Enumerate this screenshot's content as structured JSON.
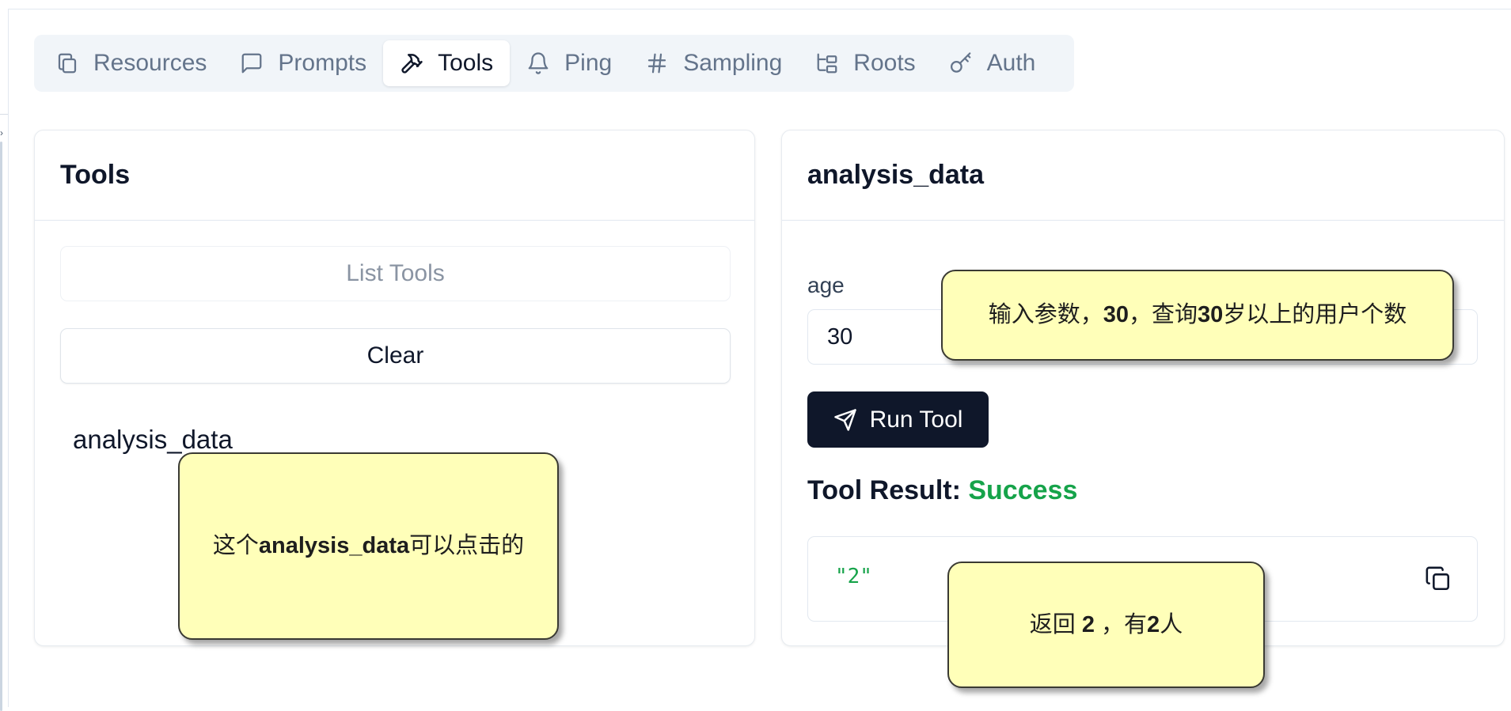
{
  "tabs": [
    {
      "label": "Resources",
      "icon": "copy-icon",
      "active": false
    },
    {
      "label": "Prompts",
      "icon": "message-square-icon",
      "active": false
    },
    {
      "label": "Tools",
      "icon": "hammer-icon",
      "active": true
    },
    {
      "label": "Ping",
      "icon": "bell-icon",
      "active": false
    },
    {
      "label": "Sampling",
      "icon": "hash-icon",
      "active": false
    },
    {
      "label": "Roots",
      "icon": "folder-tree-icon",
      "active": false
    },
    {
      "label": "Auth",
      "icon": "key-icon",
      "active": false
    }
  ],
  "tools_panel": {
    "title": "Tools",
    "list_button": "List Tools",
    "clear_button": "Clear",
    "items": [
      "analysis_data"
    ]
  },
  "tool_detail": {
    "title": "analysis_data",
    "param_label": "age",
    "param_value": "30",
    "run_button": "Run Tool",
    "result_label": "Tool Result:",
    "result_status": "Success",
    "result_value": "\"2\"",
    "copy_icon": "copy-icon"
  },
  "notes": {
    "note1_pre": "这个",
    "note1_bold": "analysis_data",
    "note1_post": "可以点击的",
    "note2_a": "输入参数，",
    "note2_b": "30",
    "note2_c": "，查询",
    "note2_d": "30",
    "note2_e": "岁以上的用户个数",
    "note3_a": "返回 ",
    "note3_b": "2",
    "note3_c": " ，有",
    "note3_d": "2",
    "note3_e": "人"
  },
  "colors": {
    "accent_dark": "#0f172a",
    "success": "#16a34a",
    "note_bg": "#ffffb9"
  }
}
